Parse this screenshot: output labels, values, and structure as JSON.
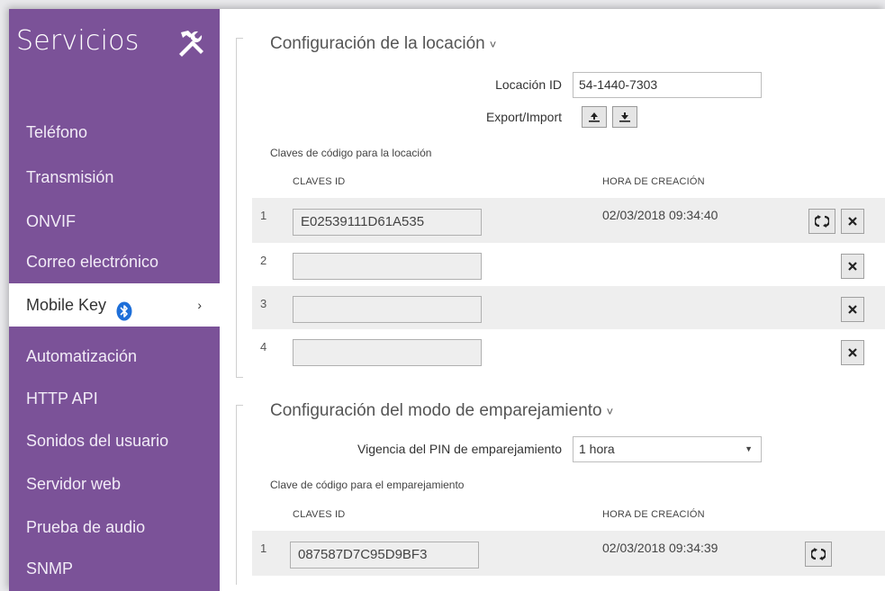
{
  "sidebar": {
    "title": "Servicios",
    "tools_icon": "tools-icon",
    "items": [
      {
        "label": "Teléfono"
      },
      {
        "label": "Transmisión"
      },
      {
        "label": "ONVIF"
      },
      {
        "label": "Correo electrónico"
      },
      {
        "label": "Mobile Key",
        "active": true,
        "icon": "bluetooth-icon",
        "chevron": "›"
      },
      {
        "label": "Automatización"
      },
      {
        "label": "HTTP API"
      },
      {
        "label": "Sonidos del usuario"
      },
      {
        "label": "Servidor web"
      },
      {
        "label": "Prueba de audio"
      },
      {
        "label": "SNMP"
      }
    ]
  },
  "location": {
    "title": "Configuración de la locación",
    "caret": "˅",
    "id_label": "Locación ID",
    "id_value": "54-1440-7303",
    "export_label": "Export/Import",
    "keys_label": "Claves de código para la locación",
    "col_keys": "CLAVES ID",
    "col_time": "HORA DE CREACIÓN",
    "rows": [
      {
        "num": "1",
        "key": "E02539111D61A535",
        "time": "02/03/2018 09:34:40"
      },
      {
        "num": "2",
        "key": "",
        "time": ""
      },
      {
        "num": "3",
        "key": "",
        "time": ""
      },
      {
        "num": "4",
        "key": "",
        "time": ""
      }
    ]
  },
  "pairing": {
    "title": "Configuración del modo de emparejamiento",
    "caret": "˅",
    "pin_label": "Vigencia del PIN de emparejamiento",
    "pin_value": "1 hora",
    "keys_label": "Clave de código para el emparejamiento",
    "col_keys": "CLAVES ID",
    "col_time": "HORA DE CREACIÓN",
    "rows": [
      {
        "num": "1",
        "key": "087587D7C95D9BF3",
        "time": "02/03/2018 09:34:39"
      }
    ]
  },
  "colors": {
    "sidebar_bg": "#7b5298",
    "bluetooth": "#1e6fd9",
    "row_shade": "#eeeeee"
  }
}
